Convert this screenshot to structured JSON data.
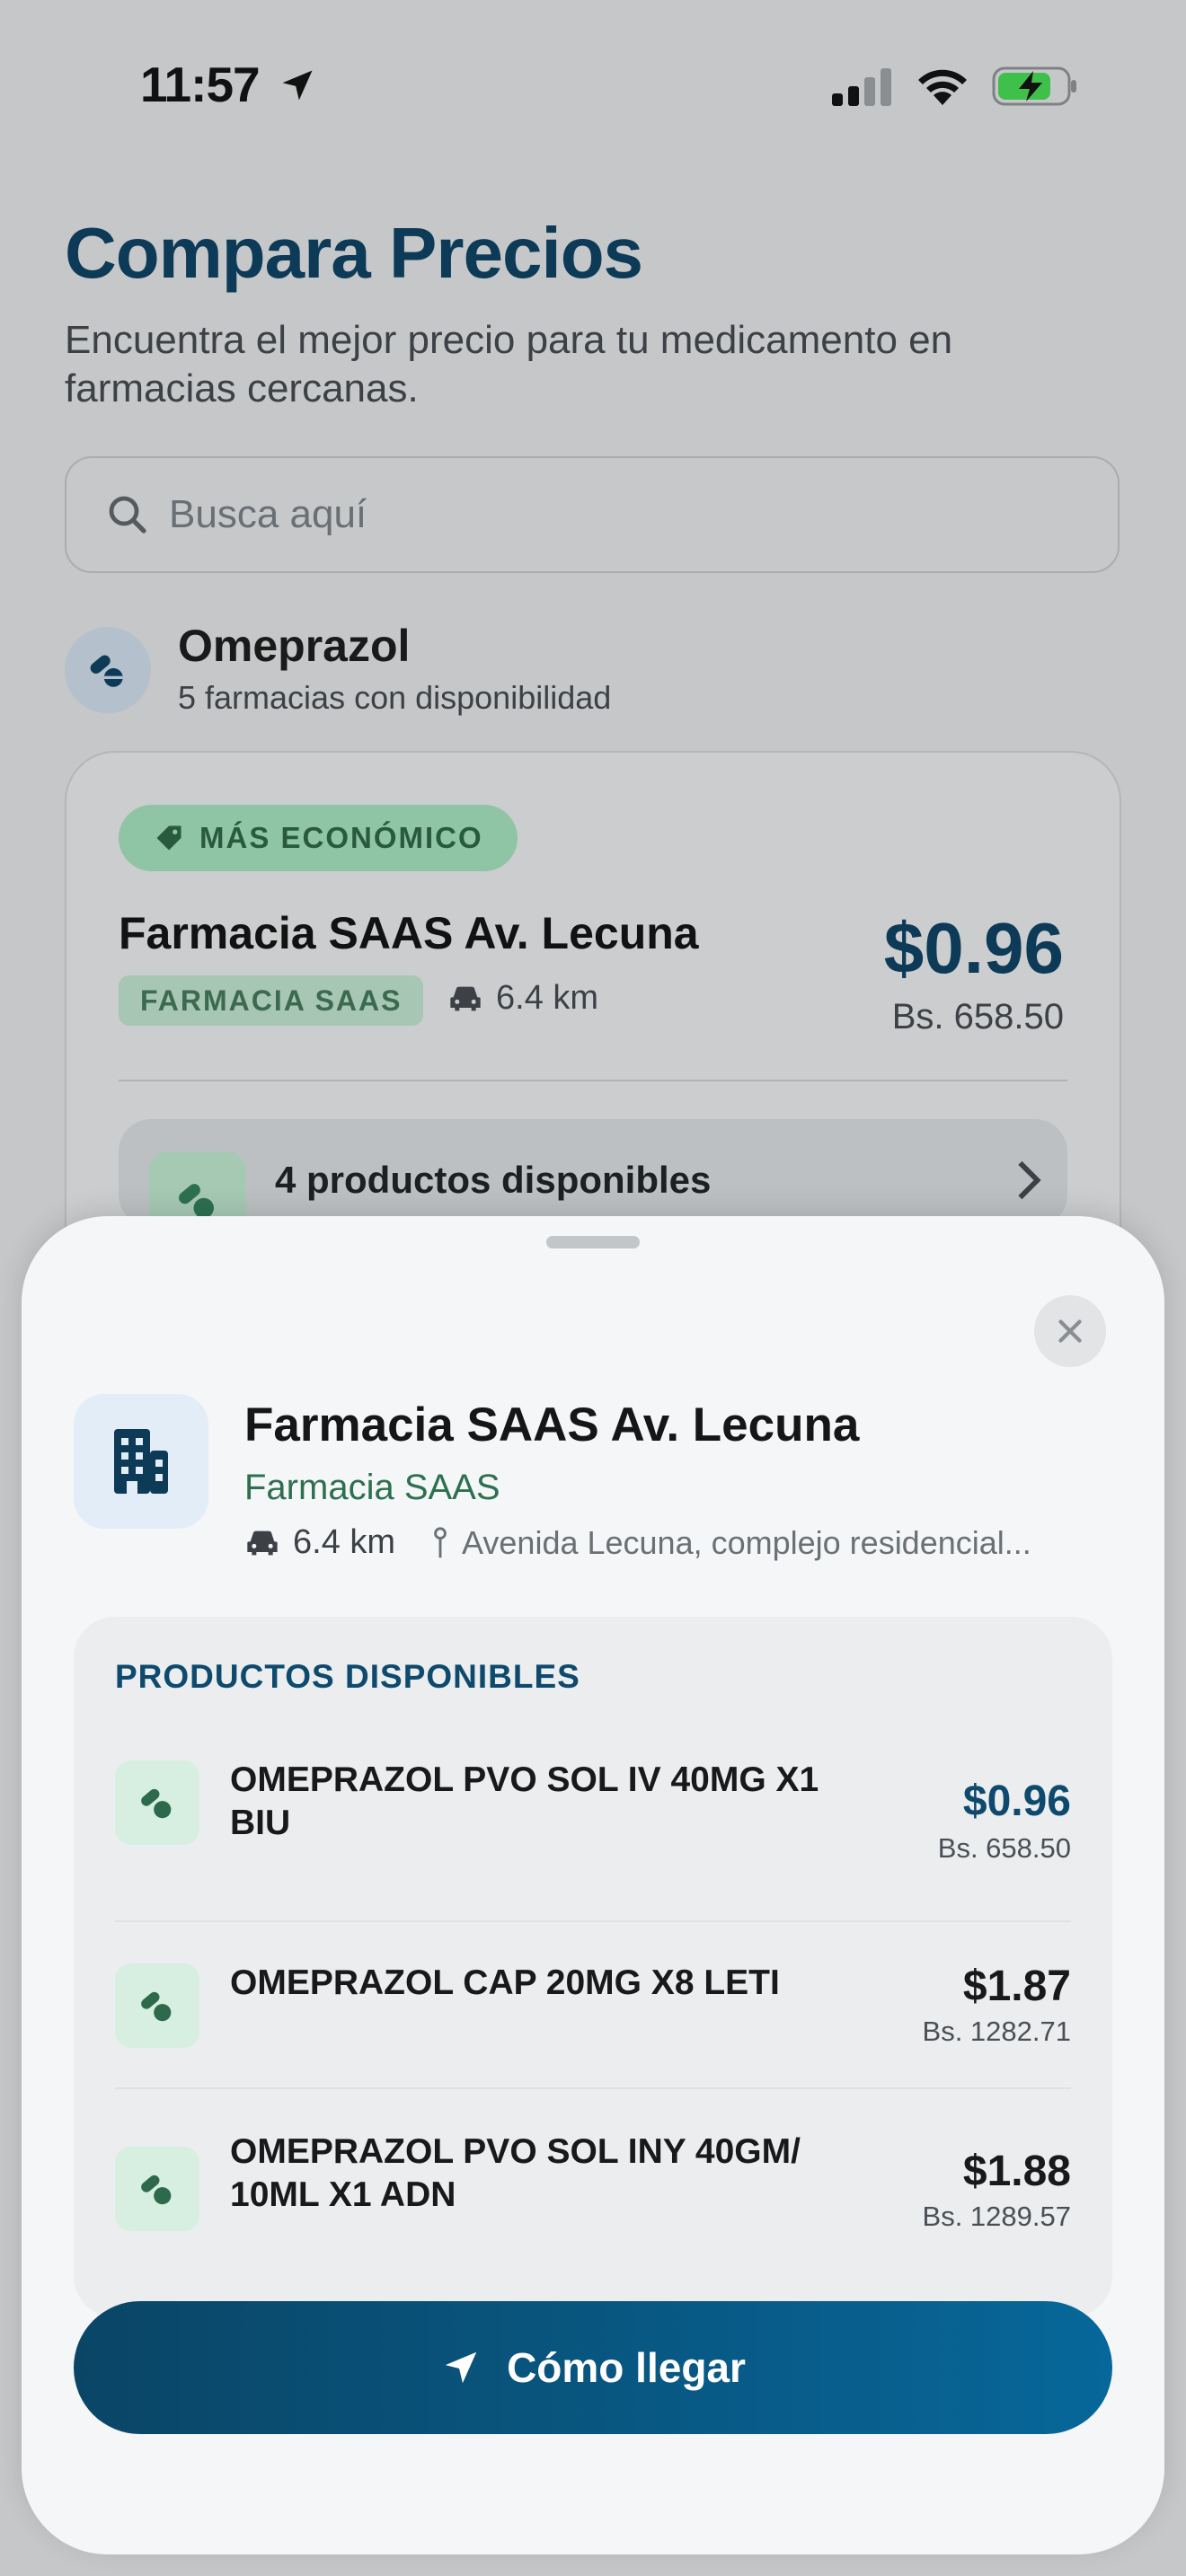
{
  "status_bar": {
    "time": "11:57"
  },
  "header": {
    "title": "Compara Precios",
    "subtitle": "Encuentra el mejor precio para tu medicamento en farmacias cercanas."
  },
  "search": {
    "placeholder": "Busca aquí"
  },
  "drug": {
    "name": "Omeprazol",
    "availability": "5 farmacias con disponibilidad"
  },
  "best_card": {
    "badge": "MÁS ECONÓMICO",
    "pharmacy": "Farmacia SAAS Av. Lecuna",
    "chain": "FARMACIA SAAS",
    "distance": "6.4 km",
    "price_usd": "$0.96",
    "price_bs": "Bs. 658.50",
    "products_label": "4 productos disponibles"
  },
  "sheet": {
    "store_name": "Farmacia SAAS Av. Lecuna",
    "store_chain": "Farmacia SAAS",
    "distance": "6.4 km",
    "address": "Avenida Lecuna, complejo residencial...",
    "products_title": "PRODUCTOS DISPONIBLES",
    "products": [
      {
        "name": "OMEPRAZOL PVO SOL IV 40MG X1 BIU",
        "usd": "$0.96",
        "bs": "Bs. 658.50"
      },
      {
        "name": "OMEPRAZOL CAP 20MG X8 LETI",
        "usd": "$1.87",
        "bs": "Bs. 1282.71"
      },
      {
        "name": "OMEPRAZOL PVO SOL INY 40GM/ 10ML X1 ADN",
        "usd": "$1.88",
        "bs": "Bs. 1289.57"
      }
    ],
    "cta_label": "Cómo llegar"
  },
  "colors": {
    "primary": "#0c3a57",
    "accent_green": "#2d7050",
    "cta_start": "#0a4566",
    "cta_end": "#07679a"
  }
}
